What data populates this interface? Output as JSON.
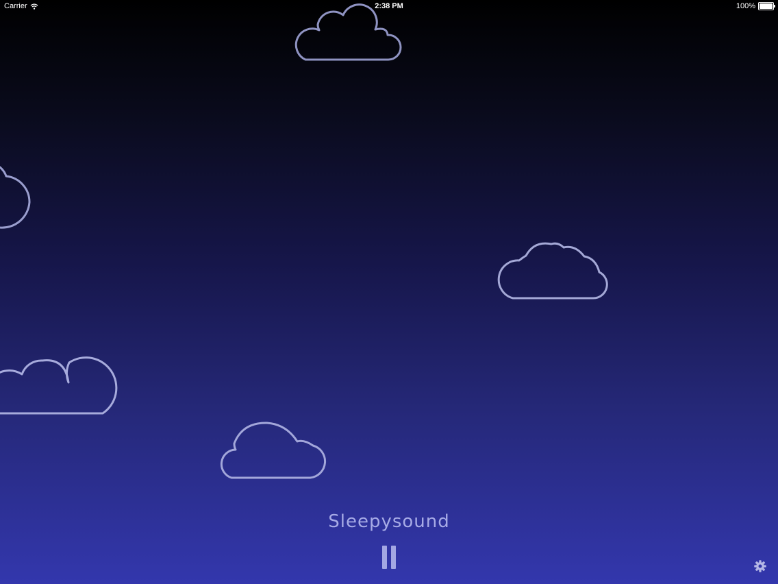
{
  "status_bar": {
    "carrier": "Carrier",
    "time": "2:38 PM",
    "battery": "100%",
    "battery_level": 1.0,
    "wifi_icon": "wifi-icon"
  },
  "app": {
    "title": "Sleepysound"
  },
  "controls": {
    "playback_icon": "pause-icon",
    "settings_icon": "gear-icon"
  },
  "colors": {
    "background_top": "#000000",
    "background_bottom": "#3337ad",
    "cloud_stroke": "#9ea2d6",
    "title_text": "#a7abe6",
    "control_accent": "#a3a7e3"
  }
}
